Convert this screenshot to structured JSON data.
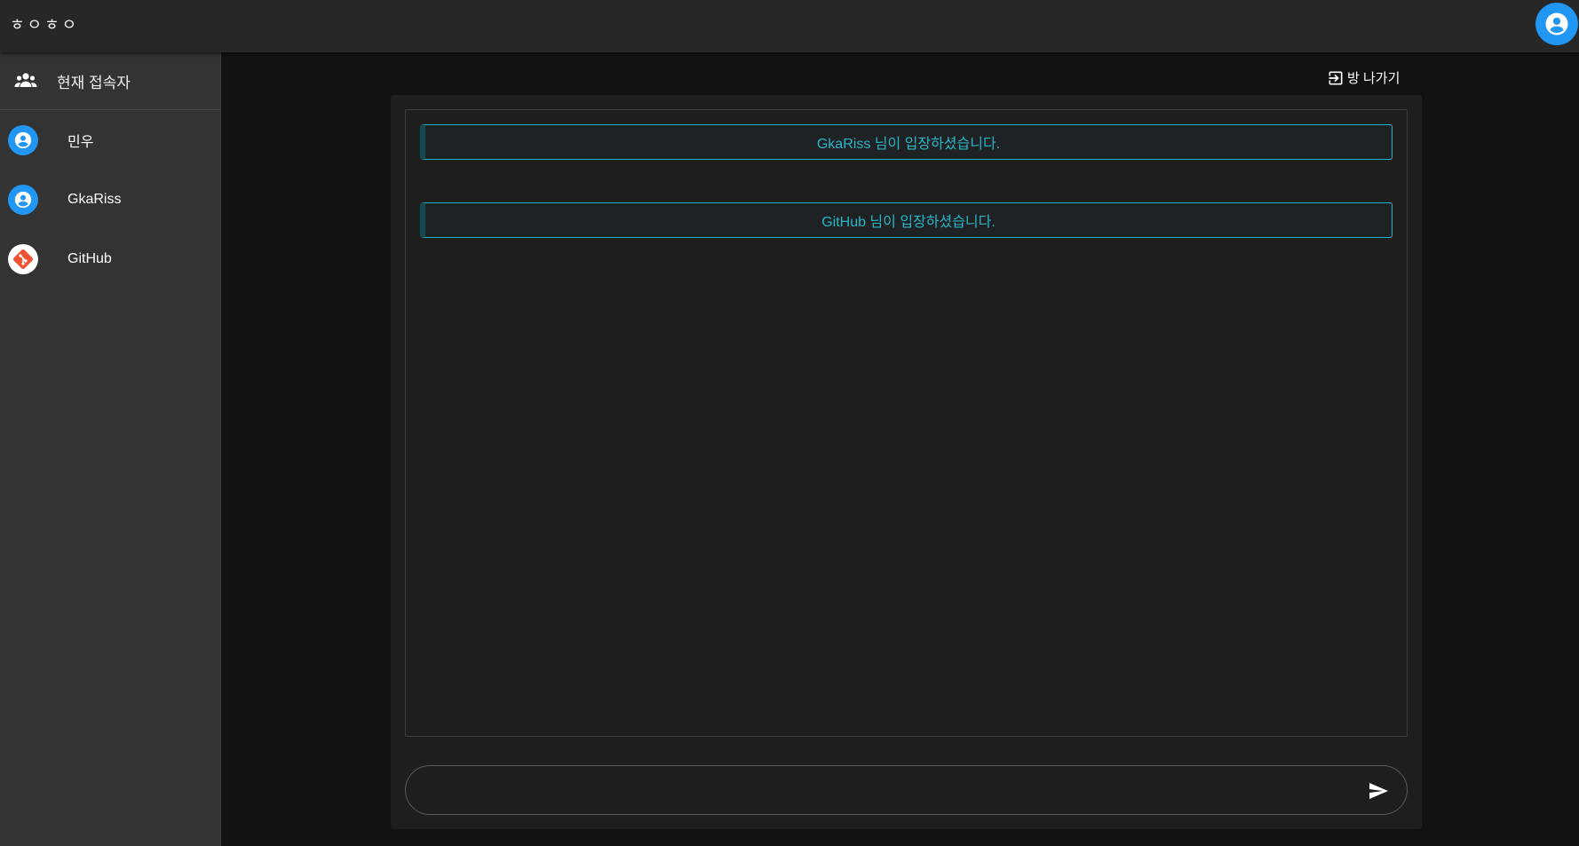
{
  "app": {
    "brand": "ㅎㅇㅎㅇ"
  },
  "sidebar": {
    "header_label": "현재 접속자",
    "users": [
      {
        "name": "민우",
        "avatar": "account-circle-icon"
      },
      {
        "name": "GkaRiss",
        "avatar": "account-circle-icon"
      },
      {
        "name": "GitHub",
        "avatar": "git-logo-icon"
      }
    ]
  },
  "room": {
    "leave_label": "방 나가기"
  },
  "messages": [
    {
      "type": "system",
      "text": "GkaRiss 님이 입장하셨습니다."
    },
    {
      "type": "system",
      "text": "GitHub 님이 입장하셨습니다."
    }
  ],
  "input": {
    "value": "",
    "placeholder": ""
  },
  "colors": {
    "appbar": "#272727",
    "sidebar": "#333333",
    "background": "#121212",
    "panel": "#1e1e1e",
    "accent": "#2196f3",
    "system_text": "#29b6c6",
    "system_border": "#1fb3c7",
    "git": "#f05033"
  }
}
